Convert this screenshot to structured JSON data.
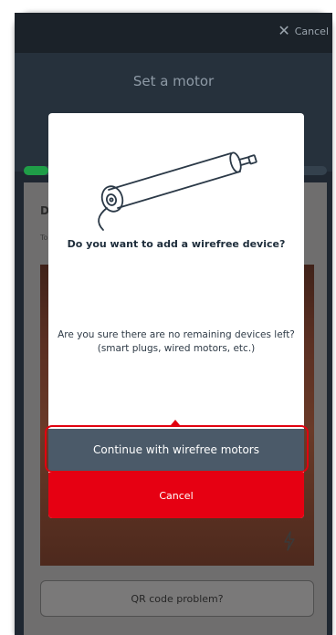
{
  "header": {
    "cancel_label": "Cancel",
    "title": "Set a motor"
  },
  "progress": {
    "fraction": 0.08,
    "color": "#1f9d47"
  },
  "background_card": {
    "title_fragment": "D",
    "subtitle_fragment": "To",
    "qr_button_label": "QR code problem?"
  },
  "modal": {
    "heading": "Do you want to add a wirefree device?",
    "body": "Are you sure there are no remaining devices left?  (smart plugs, wired motors, etc.)",
    "continue_label": "Continue with wirefree motors",
    "cancel_label": "Cancel",
    "continue_color": "#4b5a69",
    "cancel_color": "#e60012"
  },
  "icons": {
    "close": "close-icon",
    "motor": "motor-illustration",
    "flash": "flash-icon"
  }
}
